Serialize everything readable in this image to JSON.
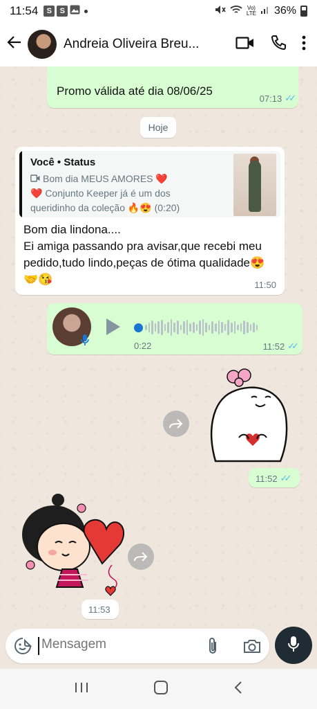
{
  "status_bar": {
    "time": "11:54",
    "notification_icons": [
      "S",
      "S"
    ],
    "battery": "36%"
  },
  "header": {
    "contact_name": "Andreia Oliveira Breu..."
  },
  "messages": {
    "promo": {
      "text": "Promo válida até dia 08/06/25",
      "time": "07:13"
    },
    "date_chip": "Hoje",
    "reply": {
      "quote_author": "Você • Status",
      "quote_line1": "Bom dia MEUS AMORES ❤️",
      "quote_line2": "❤️ Conjunto Keeper já é um dos queridinho da coleção 🔥😍 (0:20)",
      "text": "Bom dia lindona....\nEi amiga passando pra avisar,que recebi meu pedido,tudo lindo,peças de ótima qualidade😍🤝😘",
      "time": "11:50"
    },
    "voice": {
      "duration": "0:22",
      "time": "11:52"
    },
    "sticker_out": {
      "time": "11:52"
    },
    "sticker_in": {
      "time": "11:53"
    }
  },
  "composer": {
    "placeholder": "Mensagem"
  },
  "colors": {
    "outgoing_bubble": "#d9fdd3",
    "incoming_bubble": "#ffffff",
    "read_ticks": "#53bdeb",
    "mic_button": "#1f2c33"
  }
}
